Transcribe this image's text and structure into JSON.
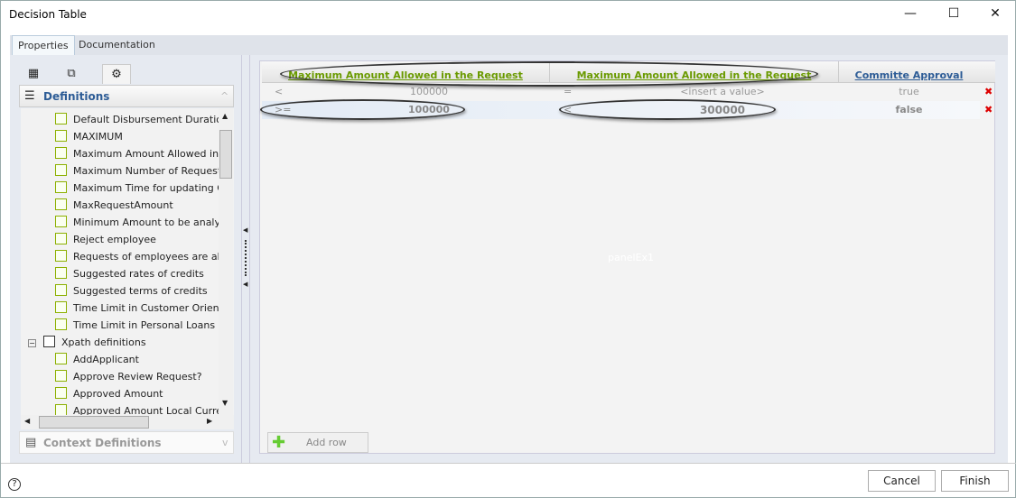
{
  "window": {
    "title": "Decision Table",
    "minimize": "—",
    "maximize": "☐",
    "close": "✕"
  },
  "tabs": [
    {
      "label": "Properties"
    },
    {
      "label": "Documentation"
    }
  ],
  "left": {
    "definitions_label": "Definitions",
    "context_label": "Context Definitions",
    "items": [
      {
        "label": "Default Disbursement Duration",
        "indent": 1
      },
      {
        "label": "MAXIMUM",
        "indent": 1
      },
      {
        "label": "Maximum Amount Allowed in t",
        "indent": 1
      },
      {
        "label": "Maximum Number of Request",
        "indent": 1
      },
      {
        "label": "Maximum Time for updating C",
        "indent": 1
      },
      {
        "label": "MaxRequestAmount",
        "indent": 1
      },
      {
        "label": "Minimum Amount to be analyz",
        "indent": 1
      },
      {
        "label": "Reject employee",
        "indent": 1
      },
      {
        "label": "Requests of employees are allo",
        "indent": 1
      },
      {
        "label": "Suggested rates of credits",
        "indent": 1
      },
      {
        "label": "Suggested terms of credits",
        "indent": 1
      },
      {
        "label": "Time Limit in Customer Orienta",
        "indent": 1
      },
      {
        "label": "Time Limit in Personal Loans R",
        "indent": 1
      },
      {
        "label": "Xpath definitions",
        "indent": 0
      },
      {
        "label": "AddApplicant",
        "indent": 1
      },
      {
        "label": "Approve Review Request?",
        "indent": 1
      },
      {
        "label": "Approved Amount",
        "indent": 1
      },
      {
        "label": "Approved Amount Local Curre",
        "indent": 1
      }
    ]
  },
  "grid": {
    "columns": [
      {
        "label": "Maximum Amount Allowed in the Request",
        "color": "#6a9a00"
      },
      {
        "label": "Maximum Amount Allowed in the Request",
        "color": "#6a9a00"
      },
      {
        "label": "Committe Approval",
        "color": "#2d5c96"
      }
    ],
    "rows": [
      {
        "op1": "<",
        "val1": "100000",
        "op2": "=",
        "val2": "<insert a value>",
        "result": "true",
        "delete": "✖"
      },
      {
        "op1": ">=",
        "val1": "100000",
        "op2": "<",
        "val2": "300000",
        "result": "false",
        "delete": "✖"
      }
    ],
    "add_row": "Add row",
    "panel_label": "panelEx1"
  },
  "footer": {
    "help": "?",
    "cancel": "Cancel",
    "finish": "Finish"
  }
}
